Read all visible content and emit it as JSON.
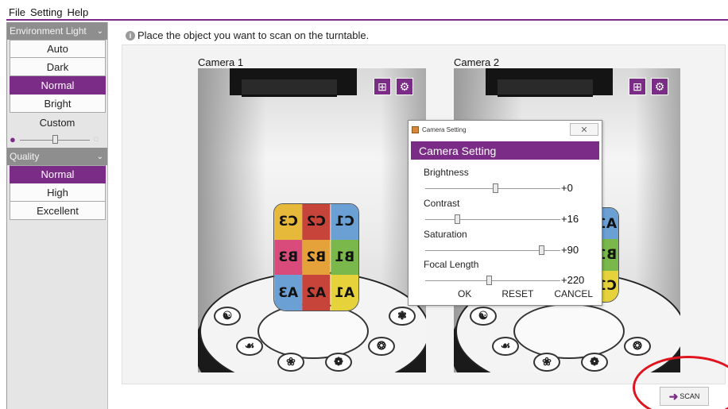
{
  "menu": [
    "File",
    "Setting",
    "Help"
  ],
  "sidebar": {
    "env_header": "Environment Light",
    "env_options": [
      {
        "label": "Auto",
        "selected": false
      },
      {
        "label": "Dark",
        "selected": false
      },
      {
        "label": "Normal",
        "selected": true
      },
      {
        "label": "Bright",
        "selected": false
      }
    ],
    "custom_label": "Custom",
    "custom_light_level": 0.5,
    "quality_header": "Quality",
    "quality_options": [
      {
        "label": "Normal",
        "selected": true
      },
      {
        "label": "High",
        "selected": false
      },
      {
        "label": "Excellent",
        "selected": false
      }
    ]
  },
  "main": {
    "instruction": "Place the object you want to scan on the turntable.",
    "camera1_label": "Camera 1",
    "camera2_label": "Camera 2"
  },
  "dialog": {
    "window_title": "Camera Setting",
    "close_glyph": "✕",
    "heading": "Camera Setting",
    "fields": [
      {
        "label": "Brightness",
        "value": "+0",
        "level": 0.52
      },
      {
        "label": "Contrast",
        "value": "+16",
        "level": 0.23
      },
      {
        "label": "Saturation",
        "value": "+90",
        "level": 0.88
      },
      {
        "label": "Focal Length",
        "value": "+220",
        "level": 0.47
      }
    ],
    "ok_label": "OK",
    "reset_label": "RESET",
    "cancel_label": "CANCEL"
  },
  "scan_label": "SCAN",
  "colors": {
    "accent": "#7b2c86",
    "highlight_ring": "#e0141e"
  }
}
